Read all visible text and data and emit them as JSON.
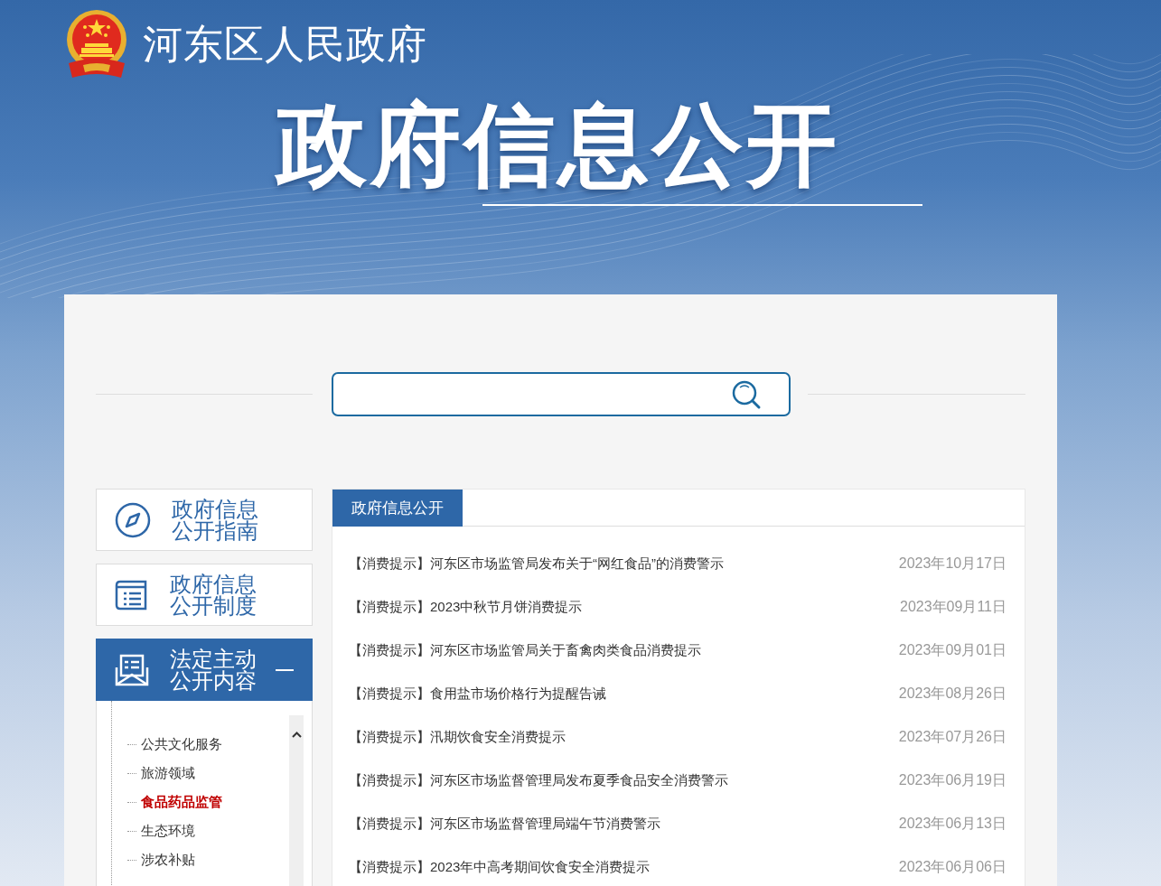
{
  "header": {
    "site_name": "河东区人民政府",
    "title": "政府信息公开"
  },
  "sidebar": {
    "cards": [
      {
        "kind": "compass",
        "label": "政府信息公开指南",
        "selected": false,
        "expanded": false
      },
      {
        "kind": "list",
        "label": "政府信息公开制度",
        "selected": false,
        "expanded": false
      },
      {
        "kind": "mail",
        "label": "法定主动公开内容",
        "selected": true,
        "expanded": true,
        "children": [
          {
            "label": "公共文化服务",
            "selected": false
          },
          {
            "label": "旅游领域",
            "selected": false
          },
          {
            "label": "食品药品监管",
            "selected": true
          },
          {
            "label": "生态环境",
            "selected": false
          },
          {
            "label": "涉农补贴",
            "selected": false
          }
        ]
      }
    ]
  },
  "content": {
    "tabs": [
      {
        "label": "政府信息公开",
        "selected": true
      }
    ],
    "rows": [
      {
        "title": "【消费提示】河东区市场监管局发布关于“网红食品”的消费警示",
        "date": "2023年10月17日"
      },
      {
        "title": "【消费提示】2023中秋节月饼消费提示",
        "date": "2023年09月11日"
      },
      {
        "title": "【消费提示】河东区市场监管局关于畜禽肉类食品消费提示",
        "date": "2023年09月01日"
      },
      {
        "title": "【消费提示】食用盐市场价格行为提醒告诫",
        "date": "2023年08月26日"
      },
      {
        "title": "【消费提示】汛期饮食安全消费提示",
        "date": "2023年07月26日"
      },
      {
        "title": "【消费提示】河东区市场监督管理局发布夏季食品安全消费警示",
        "date": "2023年06月19日"
      },
      {
        "title": "【消费提示】河东区市场监督管理局端午节消费警示",
        "date": "2023年06月13日"
      },
      {
        "title": "【消费提示】2023年中高考期间饮食安全消费提示",
        "date": "2023年06月06日"
      }
    ]
  }
}
